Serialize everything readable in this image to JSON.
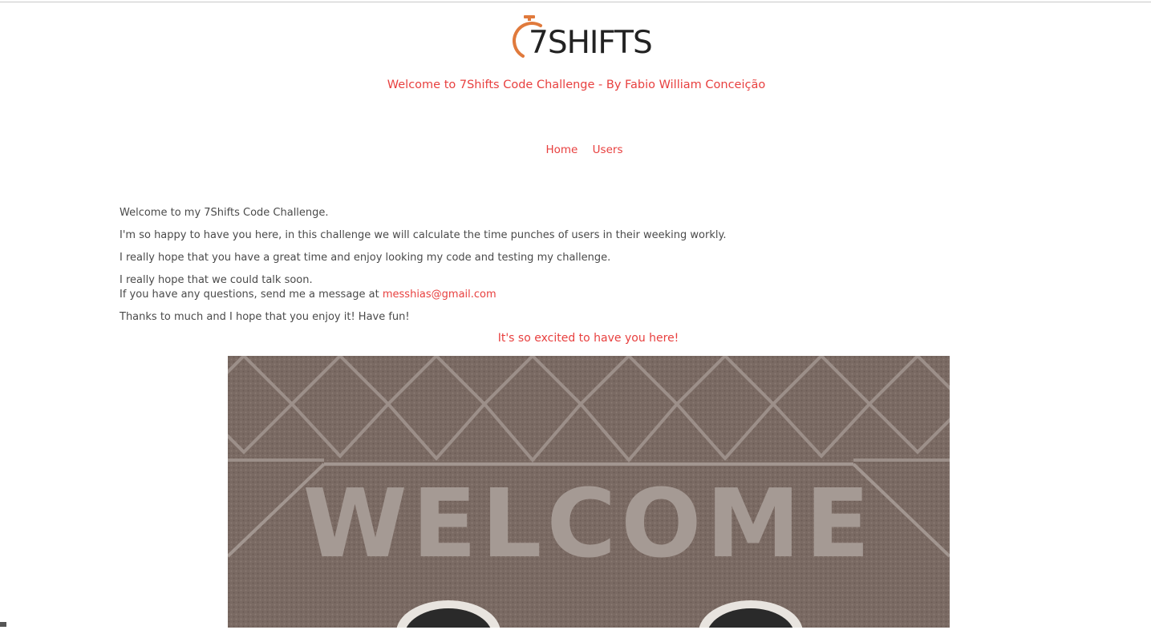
{
  "header": {
    "logo_text": "7SHIFTS",
    "subtitle": "Welcome to 7Shifts Code Challenge - By Fabio William Conceição"
  },
  "nav": {
    "items": [
      {
        "label": "Home"
      },
      {
        "label": "Users"
      }
    ]
  },
  "content": {
    "p1": "Welcome to my 7Shifts Code Challenge.",
    "p2": "I'm so happy to have you here, in this challenge we will calculate the time punches of users in their weeking workly.",
    "p3": "I really hope that you have a great time and enjoy looking my code and testing my challenge.",
    "p4_line1": "I really hope that we could talk soon.",
    "p4_line2_prefix": "If you have any questions, send me a message at ",
    "email": "messhias@gmail.com",
    "p5": "Thanks to much and I hope that you enjoy it! Have fun!",
    "excited": "It's so excited to have you here!"
  },
  "image": {
    "mat_text": "WELCOME"
  },
  "colors": {
    "accent": "#e8403f",
    "logo_orange": "#e07a3c",
    "text": "#4a4a4a",
    "mat_brown": "#7d6d66"
  }
}
